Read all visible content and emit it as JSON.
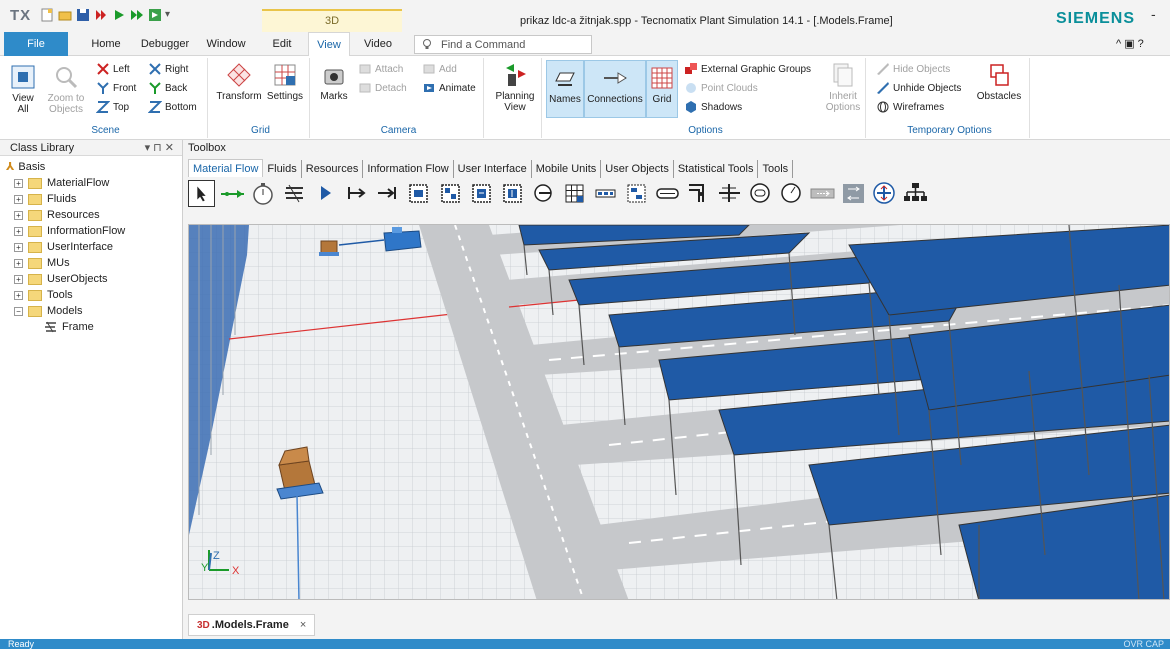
{
  "app": {
    "logo": "TX",
    "context_tab": "3D",
    "title": "prikaz ldc-a žitnjak.spp - Tecnomatix Plant Simulation 14.1 - [.Models.Frame]",
    "brand": "SIEMENS",
    "minimize": "-"
  },
  "ribbon_tabs": [
    "File",
    "Home",
    "Debugger",
    "Window",
    "Edit",
    "View",
    "Video"
  ],
  "find_command": {
    "placeholder": "Find a Command"
  },
  "ribbon_controls": "^ ▣ ?",
  "ribbon": {
    "scene": {
      "label": "Scene",
      "view_all": "View All",
      "zoom_to_objects": "Zoom to Objects",
      "left": "Left",
      "right": "Right",
      "front": "Front",
      "back": "Back",
      "top": "Top",
      "bottom": "Bottom"
    },
    "grid": {
      "label": "Grid",
      "transform": "Transform",
      "settings": "Settings"
    },
    "camera": {
      "label": "Camera",
      "marks": "Marks",
      "attach": "Attach",
      "detach": "Detach",
      "add": "Add",
      "animate": "Animate"
    },
    "planning": {
      "planning_view": "Planning View"
    },
    "options": {
      "label": "Options",
      "names": "Names",
      "connections": "Connections",
      "grid": "Grid",
      "external_graphic_groups": "External Graphic Groups",
      "point_clouds": "Point Clouds",
      "shadows": "Shadows",
      "inherit_options": "Inherit Options"
    },
    "temporary": {
      "label": "Temporary Options",
      "hide_objects": "Hide Objects",
      "unhide_objects": "Unhide Objects",
      "wireframes": "Wireframes",
      "obstacles": "Obstacles"
    }
  },
  "class_library": {
    "title": "Class Library",
    "controls": "▾ ⊓ ✕",
    "root": "Basis",
    "items": [
      "MaterialFlow",
      "Fluids",
      "Resources",
      "InformationFlow",
      "UserInterface",
      "MUs",
      "UserObjects",
      "Tools",
      "Models"
    ],
    "child": "Frame"
  },
  "toolbox": {
    "title": "Toolbox",
    "tabs": [
      "Material Flow",
      "Fluids",
      "Resources",
      "Information Flow",
      "User Interface",
      "Mobile Units",
      "User Objects",
      "Statistical Tools",
      "Tools"
    ]
  },
  "doc_tab": {
    "prefix": "3D",
    "label": ".Models.Frame",
    "close": "×"
  },
  "status": {
    "left": "Ready",
    "right": "OVR CAP"
  },
  "colors": {
    "accent": "#2f8bc9",
    "brand": "#0a8f9a",
    "shelf": "#1f5aa6",
    "floor": "#e9ecee"
  }
}
